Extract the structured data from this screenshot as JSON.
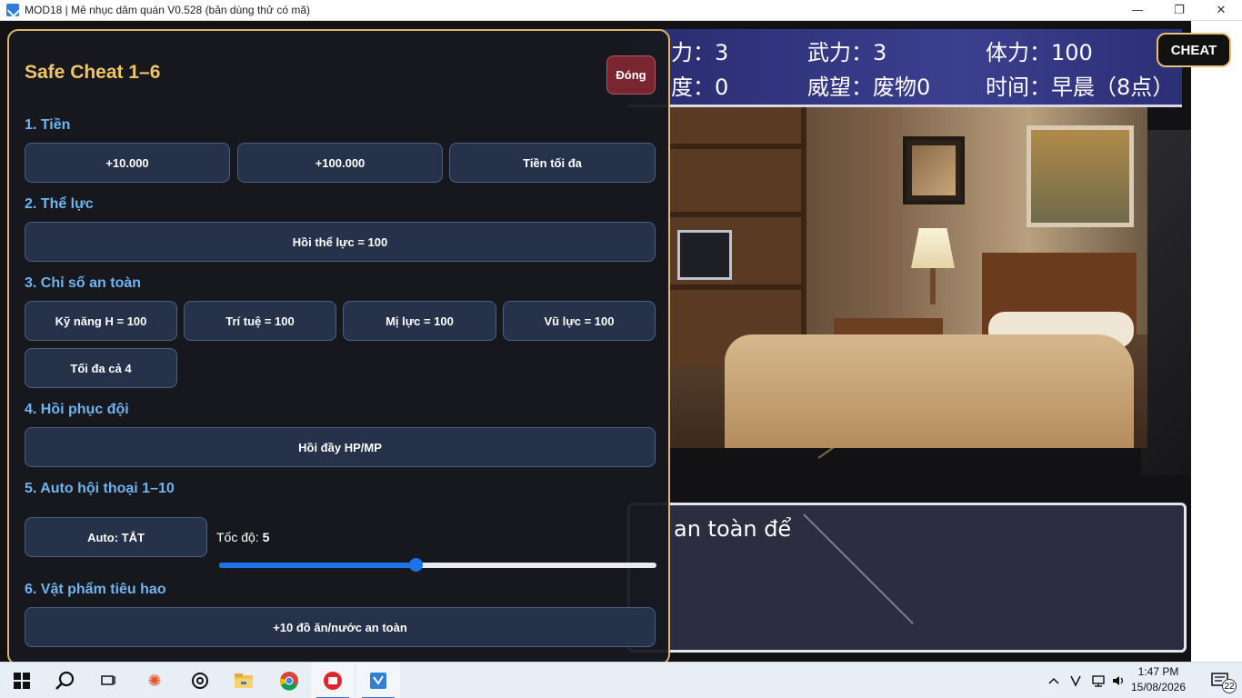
{
  "window": {
    "title": "MOD18 | Mê nhục dâm quán V0.528 (bản dùng thử có mã)",
    "minimize": "—",
    "maximize": "❐",
    "close": "✕"
  },
  "stats": {
    "row1": [
      "力：3",
      "武力：3",
      "体力：100"
    ],
    "row2": [
      "度：0",
      "威望：废物0",
      "时间：早晨（8点）"
    ]
  },
  "cheat_button": "CHEAT",
  "dialog": {
    "text": "an toàn để"
  },
  "panel": {
    "title": "Safe Cheat 1–6",
    "close_label": "Đóng",
    "sections": {
      "money": {
        "heading": "1. Tiền",
        "buttons": [
          "+10.000",
          "+100.000",
          "Tiền tối đa"
        ]
      },
      "stamina": {
        "heading": "2. Thể lực",
        "buttons": [
          "Hồi thể lực = 100"
        ]
      },
      "safe_stats": {
        "heading": "3. Chỉ số an toàn",
        "buttons": [
          "Kỹ năng H = 100",
          "Trí tuệ = 100",
          "Mị lực = 100",
          "Vũ lực = 100",
          "Tối đa cả 4"
        ]
      },
      "party": {
        "heading": "4. Hồi phục đội",
        "buttons": [
          "Hồi đầy HP/MP"
        ]
      },
      "auto": {
        "heading": "5. Auto hội thoại 1–10",
        "toggle_label": "Auto: TẮT",
        "speed_label": "Tốc độ:",
        "speed_value": "5",
        "speed_fraction": 0.45
      },
      "items": {
        "heading": "6. Vật phẩm tiêu hao",
        "buttons": [
          "+10 đồ ăn/nước an toàn"
        ]
      }
    }
  },
  "taskbar": {
    "time": "1:47 PM",
    "date": "15/08/2026",
    "notifications": "22",
    "icons": [
      "windows-icon",
      "search-icon",
      "task-view-icon",
      "burst-app-icon",
      "chatgpt-icon",
      "file-explorer-icon",
      "chrome-icon",
      "red-app-icon",
      "game-app-icon"
    ]
  }
}
